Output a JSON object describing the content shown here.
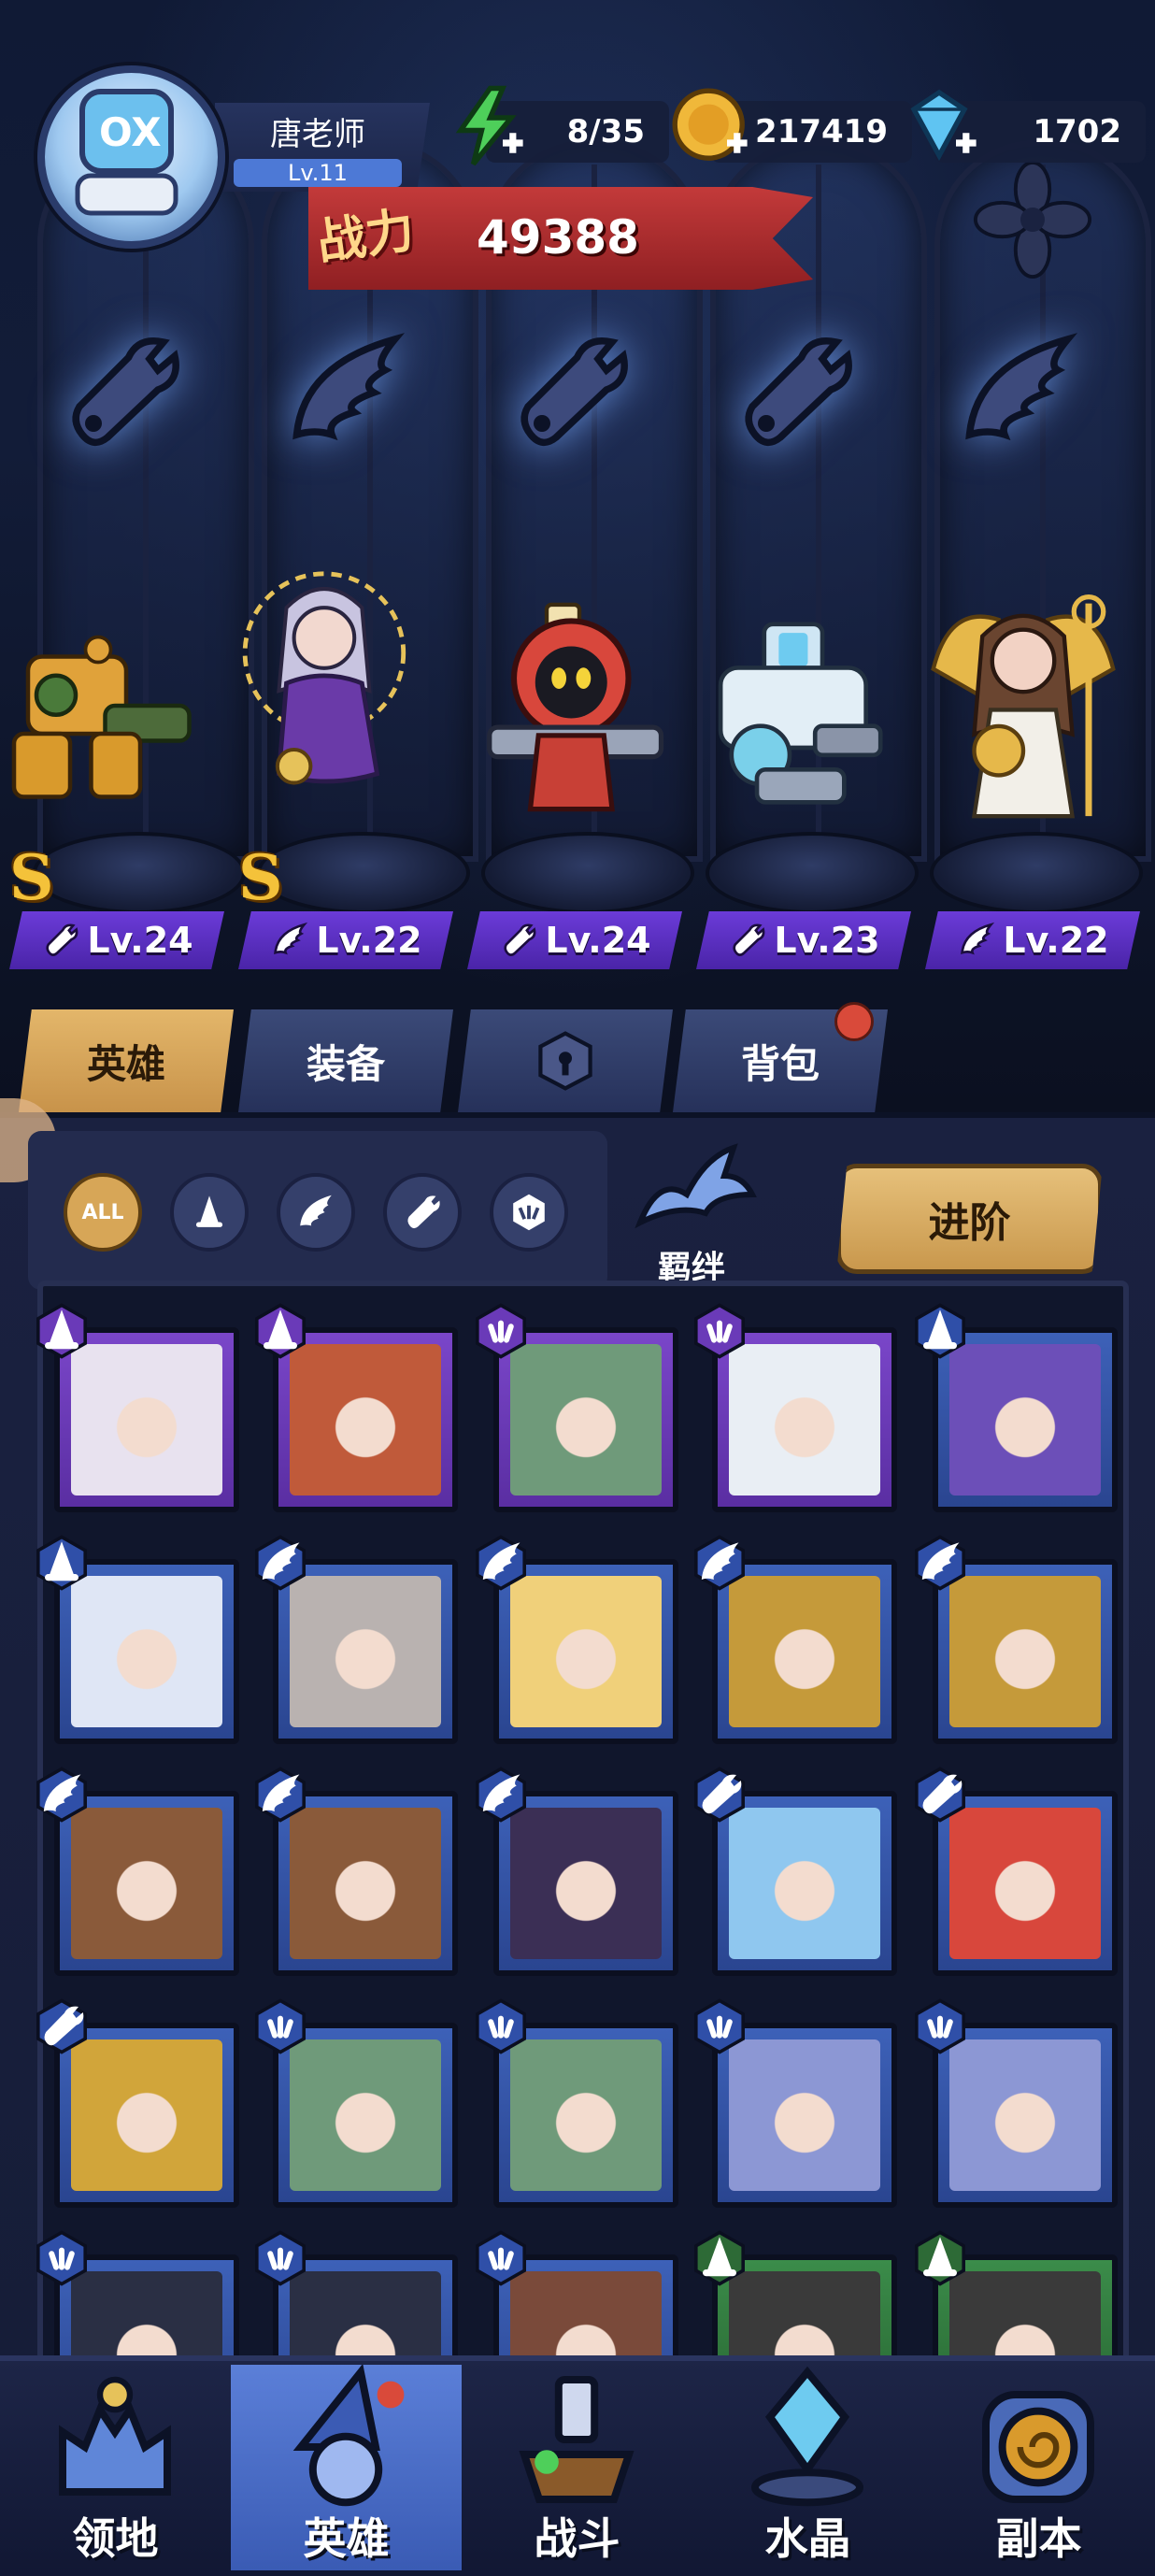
{
  "player": {
    "name": "唐老师",
    "level": "Lv.11"
  },
  "resources": [
    {
      "icon": "energy-icon",
      "value": "8/35"
    },
    {
      "icon": "gold-coin-icon",
      "value": "217419"
    },
    {
      "icon": "diamond-icon",
      "value": "1702"
    }
  ],
  "power": {
    "label": "战力",
    "value": "49388"
  },
  "lineup": [
    {
      "level": "Lv.24",
      "class": "wrench-icon",
      "rank": "S",
      "color": "#d99a2c"
    },
    {
      "level": "Lv.22",
      "class": "wing-icon",
      "rank": "S",
      "color": "#c8b6e8"
    },
    {
      "level": "Lv.24",
      "class": "wrench-icon",
      "rank": "",
      "color": "#d8473c"
    },
    {
      "level": "Lv.23",
      "class": "wrench-icon",
      "rank": "",
      "color": "#9fc6e6"
    },
    {
      "level": "Lv.22",
      "class": "wing-icon",
      "rank": "",
      "color": "#8a5a3a"
    }
  ],
  "tabs": [
    {
      "label": "英雄",
      "active": true
    },
    {
      "label": "装备",
      "active": false
    },
    {
      "label": "",
      "icon": "lock-icon",
      "active": false
    },
    {
      "label": "背包",
      "active": false,
      "dot": true
    }
  ],
  "filters": [
    {
      "label": "ALL",
      "icon": "all-icon",
      "active": true
    },
    {
      "icon": "mage-hat-icon"
    },
    {
      "icon": "wing-icon"
    },
    {
      "icon": "wrench-icon"
    },
    {
      "icon": "claw-icon"
    }
  ],
  "bond_label": "羁绊",
  "advance_label": "进阶",
  "roster": [
    {
      "rarity": "purple",
      "badge": "mage-hat-icon",
      "face": "#e8e2ef"
    },
    {
      "rarity": "purple",
      "badge": "mage-hat-icon",
      "face": "#c05a3a"
    },
    {
      "rarity": "purple",
      "badge": "claw-icon",
      "face": "#6f9a7a"
    },
    {
      "rarity": "purple",
      "badge": "claw-icon",
      "face": "#e9eef4"
    },
    {
      "rarity": "blue",
      "badge": "mage-hat-icon",
      "face": "#6c4fb8"
    },
    {
      "rarity": "blue",
      "badge": "mage-hat-icon",
      "face": "#dfe6f5"
    },
    {
      "rarity": "blue",
      "badge": "wing-icon",
      "face": "#b9b2b0"
    },
    {
      "rarity": "blue",
      "badge": "wing-icon",
      "face": "#f0d07a"
    },
    {
      "rarity": "blue",
      "badge": "wing-icon",
      "face": "#c59a3a"
    },
    {
      "rarity": "blue",
      "badge": "wing-icon",
      "face": "#c59a3a"
    },
    {
      "rarity": "blue",
      "badge": "wing-icon",
      "face": "#8a5a3a"
    },
    {
      "rarity": "blue",
      "badge": "wing-icon",
      "face": "#8a5a3a"
    },
    {
      "rarity": "blue",
      "badge": "wing-icon",
      "face": "#3b2f55"
    },
    {
      "rarity": "blue",
      "badge": "wrench-icon",
      "face": "#8fc7ef"
    },
    {
      "rarity": "blue",
      "badge": "wrench-icon",
      "face": "#d8473c"
    },
    {
      "rarity": "blue",
      "badge": "wrench-icon",
      "face": "#d1a53a"
    },
    {
      "rarity": "blue",
      "badge": "claw-icon",
      "face": "#6f9a7a"
    },
    {
      "rarity": "blue",
      "badge": "claw-icon",
      "face": "#6f9a7a"
    },
    {
      "rarity": "blue",
      "badge": "claw-icon",
      "face": "#8c97d4"
    },
    {
      "rarity": "blue",
      "badge": "claw-icon",
      "face": "#8c97d4"
    },
    {
      "rarity": "blue",
      "badge": "claw-icon",
      "face": "#2a2f44"
    },
    {
      "rarity": "blue",
      "badge": "claw-icon",
      "face": "#2a2f44"
    },
    {
      "rarity": "blue",
      "badge": "claw-icon",
      "face": "#7a4a3a"
    },
    {
      "rarity": "green",
      "badge": "mage-hat-icon",
      "face": "#3a3a3a"
    },
    {
      "rarity": "green",
      "badge": "mage-hat-icon",
      "face": "#3a3a3a"
    }
  ],
  "nav": [
    {
      "label": "领地",
      "icon": "territory-icon",
      "active": false
    },
    {
      "label": "英雄",
      "icon": "hero-wizard-icon",
      "active": true
    },
    {
      "label": "战斗",
      "icon": "battle-icon",
      "active": false
    },
    {
      "label": "水晶",
      "icon": "crystal-icon",
      "active": false
    },
    {
      "label": "副本",
      "icon": "dungeon-icon",
      "active": false
    }
  ]
}
